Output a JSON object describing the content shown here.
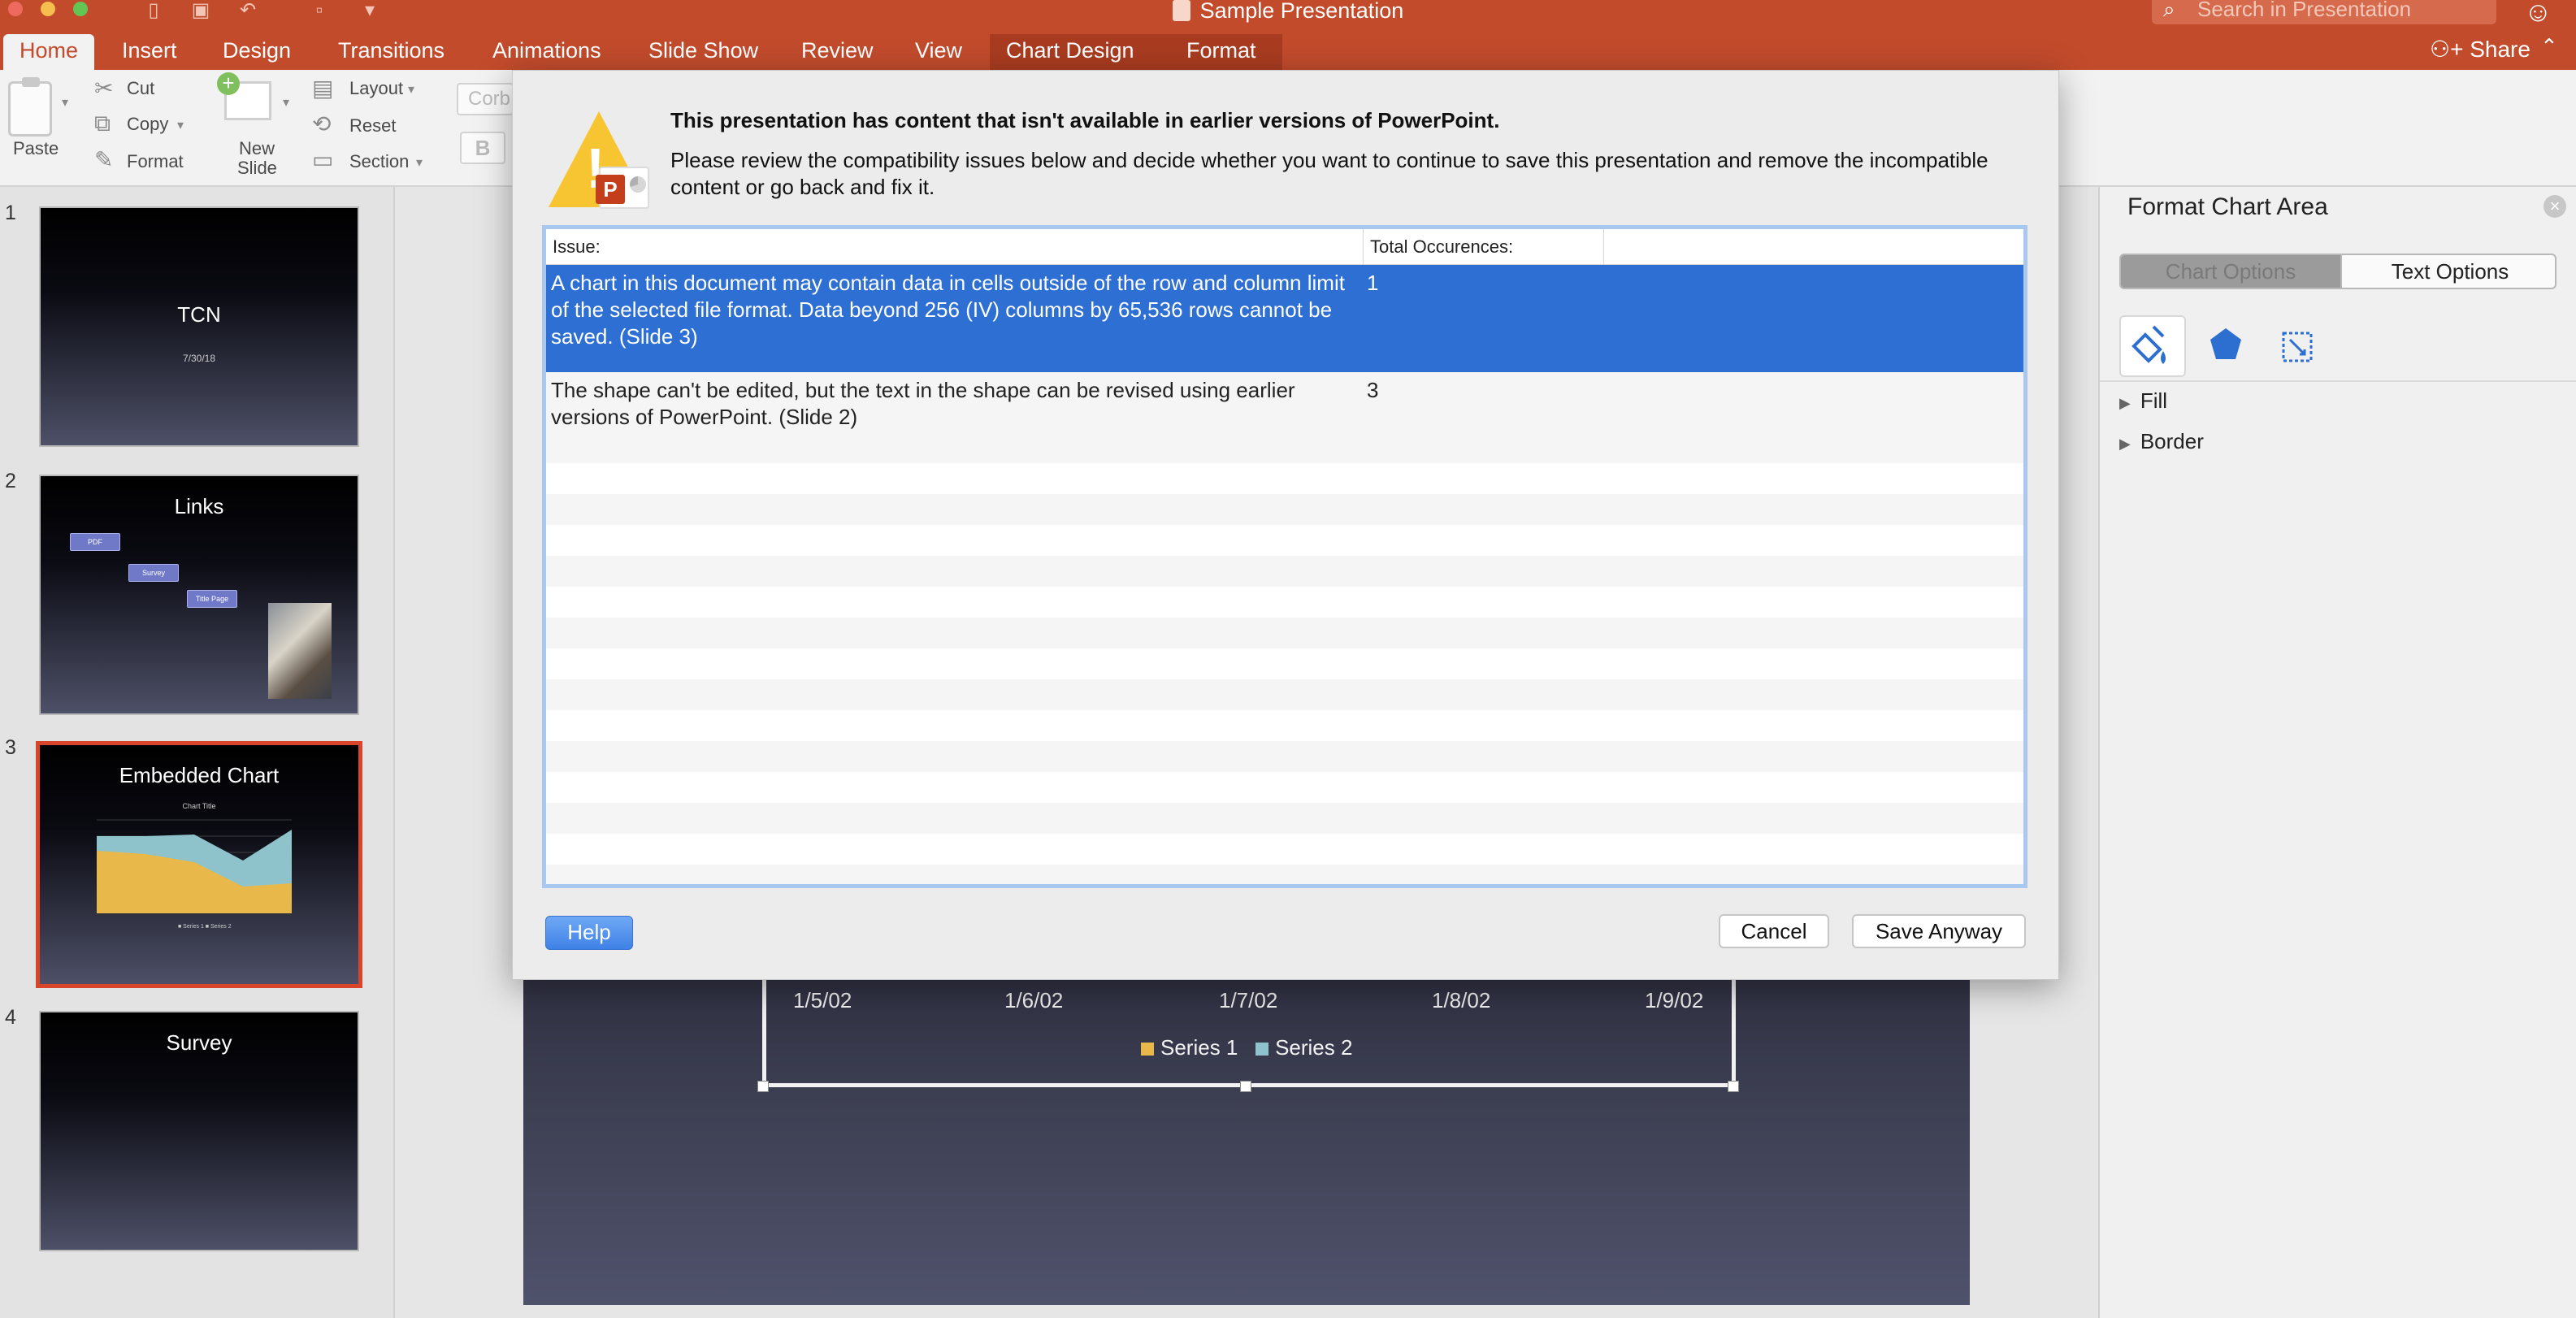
{
  "window": {
    "title": "Sample Presentation"
  },
  "search": {
    "placeholder": "Search in Presentation"
  },
  "share_label": "Share",
  "tabs": [
    {
      "label": "Home"
    },
    {
      "label": "Insert"
    },
    {
      "label": "Design"
    },
    {
      "label": "Transitions"
    },
    {
      "label": "Animations"
    },
    {
      "label": "Slide Show"
    },
    {
      "label": "Review"
    },
    {
      "label": "View"
    },
    {
      "label": "Chart Design"
    },
    {
      "label": "Format"
    }
  ],
  "ribbon": {
    "paste": "Paste",
    "cut": "Cut",
    "copy": "Copy",
    "format": "Format",
    "new_slide_line1": "New",
    "new_slide_line2": "Slide",
    "layout": "Layout",
    "reset": "Reset",
    "section": "Section",
    "font_prefix": "Corb",
    "bold": "B"
  },
  "slides": [
    {
      "num": "1",
      "title": "TCN",
      "subtitle": "7/30/18"
    },
    {
      "num": "2",
      "title": "Links",
      "buttons": [
        "PDF",
        "Survey",
        "Title Page"
      ]
    },
    {
      "num": "3",
      "title": "Embedded Chart",
      "chart_title": "Chart Title"
    },
    {
      "num": "4",
      "title": "Survey"
    }
  ],
  "main_chart": {
    "x_ticks": [
      "1/5/02",
      "1/6/02",
      "1/7/02",
      "1/8/02",
      "1/9/02"
    ],
    "legend": [
      {
        "name": "Series 1",
        "color": "#e8b94a"
      },
      {
        "name": "Series 2",
        "color": "#8ec3cb"
      }
    ]
  },
  "format_pane": {
    "title": "Format Chart Area",
    "tab_chart_options": "Chart Options",
    "tab_text_options": "Text Options",
    "sections": [
      "Fill",
      "Border"
    ]
  },
  "dialog": {
    "heading": "This presentation has content that isn't available in earlier versions of PowerPoint.",
    "message": "Please review the compatibility issues below and decide whether you want to continue to save this presentation and remove the incompatible content or go back and fix it.",
    "col_issue": "Issue:",
    "col_total": "Total Occurences:",
    "issues": [
      {
        "issue": "A chart in this document may contain data in cells outside of the row and column limit of the selected file format. Data beyond 256 (IV) columns by 65,536 rows cannot be saved.  (Slide 3)",
        "count": "1"
      },
      {
        "issue": "The shape can't be edited, but the text in the shape can be revised using earlier versions of PowerPoint.  (Slide 2)",
        "count": "3"
      }
    ],
    "help": "Help",
    "cancel": "Cancel",
    "save_anyway": "Save Anyway"
  },
  "colors": {
    "accent": "#c24b2c",
    "selection": "#2e6fd3",
    "warning": "#f7c531"
  }
}
